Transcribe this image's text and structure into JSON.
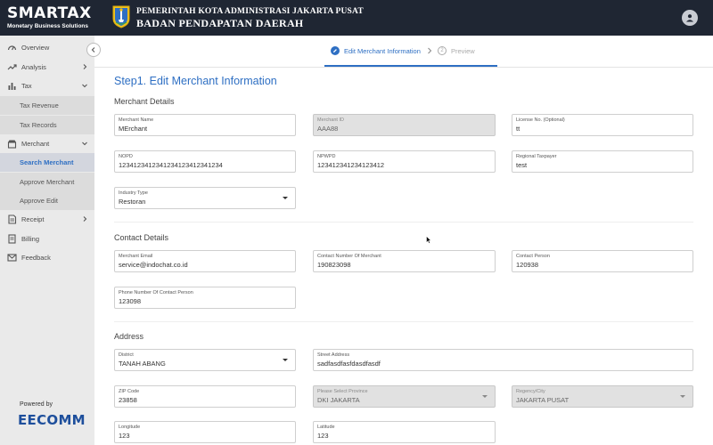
{
  "header": {
    "brand_name": "SMARTAX",
    "brand_tagline": "Monetary Business Solutions",
    "gov_line1": "PEMERINTAH KOTA ADMINISTRASI JAKARTA PUSAT",
    "gov_line2": "BADAN PENDAPATAN DAERAH"
  },
  "sidebar": {
    "items": [
      {
        "label": "Overview",
        "icon": "overview-icon"
      },
      {
        "label": "Analysis",
        "icon": "analysis-icon"
      },
      {
        "label": "Tax",
        "icon": "tax-icon"
      },
      {
        "label": "Tax Revenue"
      },
      {
        "label": "Tax Records"
      },
      {
        "label": "Merchant",
        "icon": "merchant-icon"
      },
      {
        "label": "Search Merchant"
      },
      {
        "label": "Approve Merchant"
      },
      {
        "label": "Approve Edit"
      },
      {
        "label": "Receipt",
        "icon": "receipt-icon"
      },
      {
        "label": "Billing",
        "icon": "billing-icon"
      },
      {
        "label": "Feedback",
        "icon": "feedback-icon"
      }
    ],
    "powered_by": "Powered by",
    "partner": "EECOMM"
  },
  "stepper": {
    "step1": "Edit Merchant Information",
    "step2": "Preview",
    "step2_num": "2"
  },
  "page": {
    "title": "Step1. Edit Merchant Information"
  },
  "merchant_details": {
    "heading": "Merchant Details",
    "merchant_name": {
      "label": "Merchant Name",
      "value": "MErchant"
    },
    "merchant_id": {
      "label": "Merchant ID",
      "value": "AAA88"
    },
    "license_no": {
      "label": "License No. (Optional)",
      "value": "tt"
    },
    "nopd": {
      "label": "NOPD",
      "value": "1234123412341234123412341234"
    },
    "npwpd": {
      "label": "NPWPD",
      "value": "123412341234123412"
    },
    "regional_taxpayer": {
      "label": "Regional Taxpayer",
      "value": "test"
    },
    "industry_type": {
      "label": "Industry Type",
      "value": "Restoran"
    }
  },
  "contact_details": {
    "heading": "Contact Details",
    "merchant_email": {
      "label": "Merchant Email",
      "value": "service@indochat.co.id"
    },
    "contact_number": {
      "label": "Contact Number Of Merchant",
      "value": "190823098"
    },
    "contact_person": {
      "label": "Contact Person",
      "value": "120938"
    },
    "contact_phone": {
      "label": "Phone Number Of Contact Person",
      "value": "123098"
    }
  },
  "address": {
    "heading": "Address",
    "district": {
      "label": "District",
      "value": "TANAH ABANG"
    },
    "street": {
      "label": "Street Address",
      "value": "sadfasdfasfdasdfasdf"
    },
    "zip": {
      "label": "ZIP Code",
      "value": "23858"
    },
    "province": {
      "label": "Please Select Province",
      "value": "DKI JAKARTA"
    },
    "city": {
      "label": "Regency/City",
      "value": "JAKARTA PUSAT"
    },
    "longitude": {
      "label": "Longitude",
      "value": "123"
    },
    "latitude": {
      "label": "Latitude",
      "value": "123"
    }
  },
  "colors": {
    "accent": "#2e6fc3",
    "topbar": "#1f2633",
    "sidebar": "#eaeaea"
  }
}
